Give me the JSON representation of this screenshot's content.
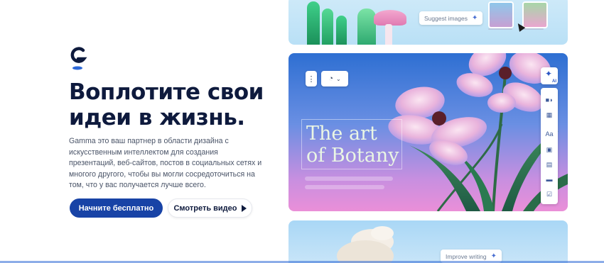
{
  "hero": {
    "logo_icon": "gamma-logo-icon",
    "headline_line1": "Воплотите свои",
    "headline_line2": "идеи в жизнь.",
    "description": "Gamma это ваш партнер в области дизайна с искусственным интеллектом для создания презентаций, веб-сайтов, постов в социальных сетях и многого другого, чтобы вы могли сосредоточиться на том, что у вас получается лучше всего.",
    "primary_button": "Начните бесплатно",
    "secondary_button": "Смотреть видео",
    "primary_color": "#1843a6"
  },
  "card_top": {
    "suggest_chip": "Suggest images"
  },
  "card_main": {
    "title_line1": "The art",
    "title_line2": "of Botany",
    "ai_badge": "AI",
    "side_tool_text": "Aa"
  },
  "card_bottom": {
    "improve_chip": "Improve writing"
  }
}
